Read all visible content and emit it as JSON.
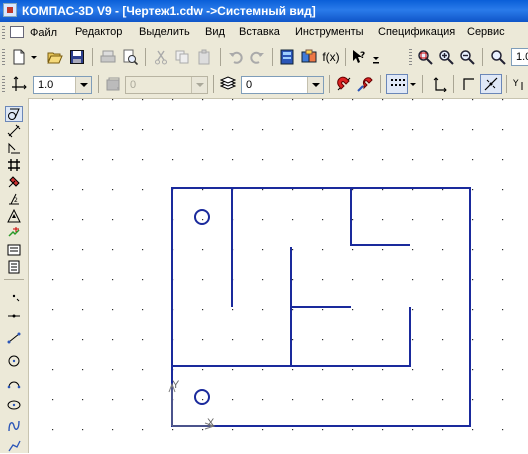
{
  "window": {
    "title": "КОМПАС-3D V9 - [Чертеж1.cdw ->Системный вид]"
  },
  "menu": {
    "items": [
      {
        "label": "Файл"
      },
      {
        "label": "Редактор"
      },
      {
        "label": "Выделить"
      },
      {
        "label": "Вид"
      },
      {
        "label": "Вставка"
      },
      {
        "label": "Инструменты"
      },
      {
        "label": "Спецификация"
      },
      {
        "label": "Сервис"
      }
    ]
  },
  "toolbar": {
    "fx_label": "f(x)",
    "scale_value": "1.0",
    "zoom_value": "1.0"
  },
  "props": {
    "line_scale_value": "1.0",
    "disabled_combo_value": "0",
    "layer_value": "0"
  },
  "canvas": {
    "axis_y": "Y",
    "axis_x": "X"
  },
  "colors": {
    "drawing_line": "#1a2a9c",
    "grid_dot": "#2a2a2a",
    "title_bar": "#0a5fd8",
    "ui_face": "#ece9d8"
  }
}
